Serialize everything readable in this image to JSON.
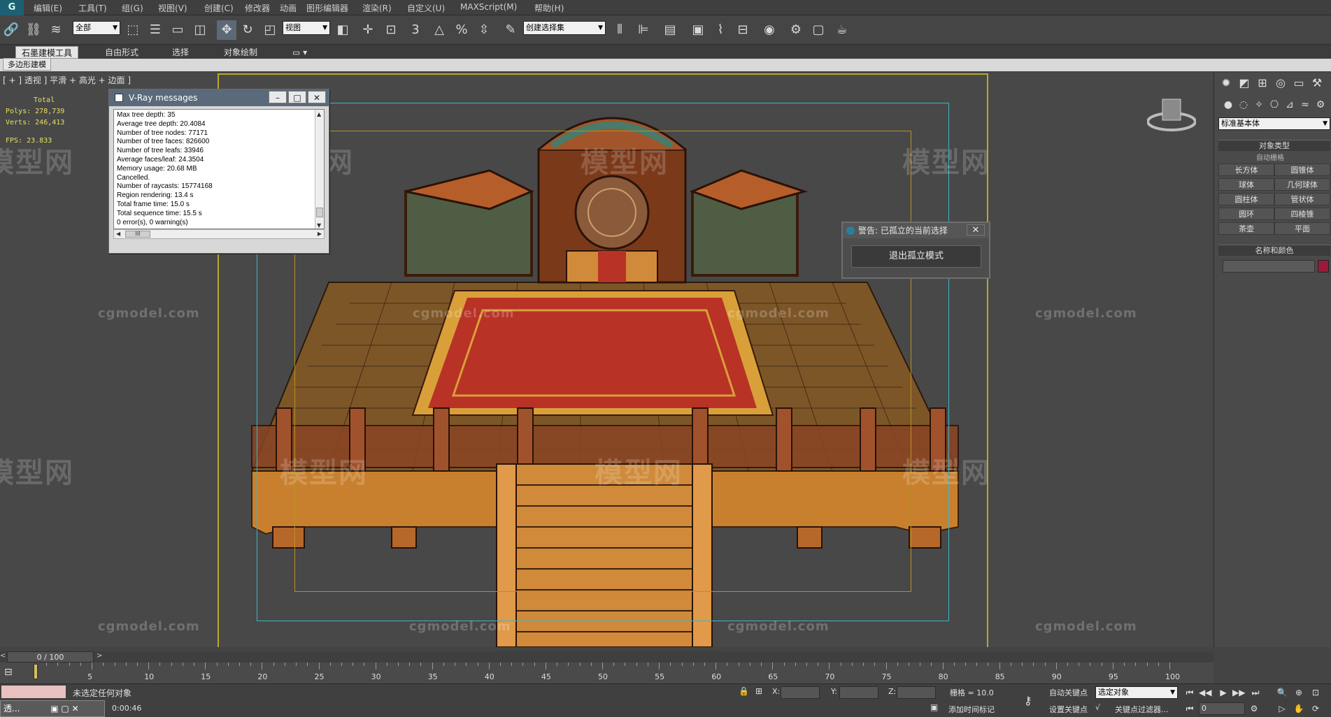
{
  "menubar": {
    "logo": "G",
    "items": [
      "编辑(E)",
      "工具(T)",
      "组(G)",
      "视图(V)",
      "创建(C)",
      "修改器",
      "动画",
      "图形编辑器",
      "渲染(R)",
      "自定义(U)",
      "MAXScript(M)",
      "帮助(H)"
    ]
  },
  "toolbar": {
    "selection_filter": "全部",
    "ref_coord": "视图",
    "named_selection": "创建选择集",
    "snap_value": "3"
  },
  "ribbon": {
    "tabs": [
      "石墨建模工具",
      "自由形式",
      "选择",
      "对象绘制"
    ],
    "sub_tab": "多边形建模"
  },
  "viewport": {
    "label": "[ + ] 透视 ] 平滑 + 高光 + 边面 ]",
    "stats": {
      "total": "Total",
      "polys_label": "Polys:",
      "polys": "278,739",
      "verts_label": "Verts:",
      "verts": "246,413",
      "fps_label": "FPS:",
      "fps": "23.833"
    },
    "watermarks": [
      "模型网",
      "模型网",
      "模型网",
      "模型网",
      "模型网",
      "模型网",
      "模型网",
      "模型网"
    ],
    "site_marks": [
      "cgmodel.com",
      "cgmodel.com",
      "cgmodel.com",
      "cgmodel.com",
      "cgmodel.com",
      "cgmodel.com",
      "cgmodel.com",
      "cgmodel.com"
    ],
    "scene_colors": {
      "carpet": "#b83226",
      "carpet_border": "#d9a03a",
      "wood": "#d98a36",
      "dark_wood": "#8a4a24",
      "frame_outer": "#b8a82a",
      "frame_safe": "#3cb6c8"
    }
  },
  "vray": {
    "title": "V-Ray messages",
    "lines": [
      "Max tree depth: 35",
      "Average tree depth: 20.4084",
      "Number of tree nodes: 77171",
      "Number of tree faces: 826600",
      "Number of tree leafs: 33946",
      "Average faces/leaf: 24.3504",
      "Memory usage: 20.68 MB",
      "Cancelled.",
      "Number of raycasts: 15774168",
      "Region rendering: 13.4 s",
      "Total frame time: 15.0 s",
      "Total sequence time: 15.5 s",
      "0 error(s), 0 warning(s)",
      "================================"
    ],
    "hscroll_thumb": "III"
  },
  "isolate": {
    "title": "警告: 已孤立的当前选择",
    "button": "退出孤立模式"
  },
  "cmdpanel": {
    "dropdown": "标准基本体",
    "rollout_object_type": "对象类型",
    "autogrid": "自动栅格",
    "buttons": [
      "长方体",
      "圆锥体",
      "球体",
      "几何球体",
      "圆柱体",
      "管状体",
      "圆环",
      "四棱锥",
      "茶壶",
      "平面"
    ],
    "rollout_name_color": "名称和颜色",
    "object_color": "#9a1a3a"
  },
  "timeline": {
    "slider": "0 / 100",
    "ticks": [
      "5",
      "10",
      "15",
      "20",
      "25",
      "30",
      "35",
      "40",
      "45",
      "50",
      "55",
      "60",
      "65",
      "70",
      "75",
      "80",
      "85",
      "90",
      "95",
      "100"
    ]
  },
  "statusbar": {
    "prompt": "未选定任何对象",
    "time": "0:00:46",
    "x_label": "X:",
    "y_label": "Y:",
    "z_label": "Z:",
    "grid": "栅格 = 10.0",
    "auto_key": "自动关键点",
    "set_key": "设置关键点",
    "key_mode": "选定对象",
    "key_filters": "关键点过滤器...",
    "add_time_tag": "添加时间标记",
    "frame": "0",
    "taskbar": "透..."
  }
}
